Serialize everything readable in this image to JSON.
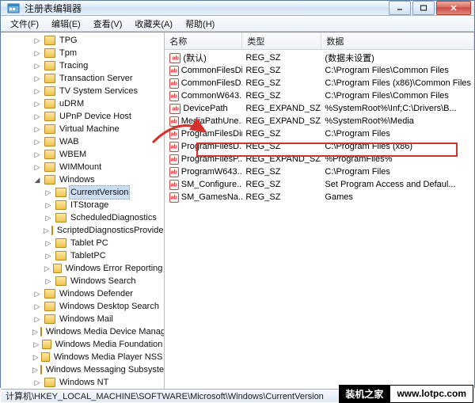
{
  "title": "注册表编辑器",
  "menu": [
    "文件(F)",
    "编辑(E)",
    "查看(V)",
    "收藏夹(A)",
    "帮助(H)"
  ],
  "tree": {
    "indent_base": 40,
    "indent_step": 14,
    "nodes": [
      {
        "label": "TPG",
        "level": 0,
        "exp": "▷"
      },
      {
        "label": "Tpm",
        "level": 0,
        "exp": "▷"
      },
      {
        "label": "Tracing",
        "level": 0,
        "exp": "▷"
      },
      {
        "label": "Transaction Server",
        "level": 0,
        "exp": "▷"
      },
      {
        "label": "TV System Services",
        "level": 0,
        "exp": "▷"
      },
      {
        "label": "uDRM",
        "level": 0,
        "exp": "▷"
      },
      {
        "label": "UPnP Device Host",
        "level": 0,
        "exp": "▷"
      },
      {
        "label": "Virtual Machine",
        "level": 0,
        "exp": "▷"
      },
      {
        "label": "WAB",
        "level": 0,
        "exp": "▷"
      },
      {
        "label": "WBEM",
        "level": 0,
        "exp": "▷"
      },
      {
        "label": "WIMMount",
        "level": 0,
        "exp": "▷"
      },
      {
        "label": "Windows",
        "level": 0,
        "exp": "◢"
      },
      {
        "label": "CurrentVersion",
        "level": 1,
        "exp": "▷",
        "selected": true
      },
      {
        "label": "ITStorage",
        "level": 1,
        "exp": "▷"
      },
      {
        "label": "ScheduledDiagnostics",
        "level": 1,
        "exp": "▷"
      },
      {
        "label": "ScriptedDiagnosticsProvider",
        "level": 1,
        "exp": "▷"
      },
      {
        "label": "Tablet PC",
        "level": 1,
        "exp": "▷"
      },
      {
        "label": "TabletPC",
        "level": 1,
        "exp": "▷"
      },
      {
        "label": "Windows Error Reporting",
        "level": 1,
        "exp": "▷"
      },
      {
        "label": "Windows Search",
        "level": 1,
        "exp": "▷"
      },
      {
        "label": "Windows Defender",
        "level": 0,
        "exp": "▷"
      },
      {
        "label": "Windows Desktop Search",
        "level": 0,
        "exp": "▷"
      },
      {
        "label": "Windows Mail",
        "level": 0,
        "exp": "▷"
      },
      {
        "label": "Windows Media Device Manager",
        "level": 0,
        "exp": "▷"
      },
      {
        "label": "Windows Media Foundation",
        "level": 0,
        "exp": "▷"
      },
      {
        "label": "Windows Media Player NSS",
        "level": 0,
        "exp": "▷"
      },
      {
        "label": "Windows Messaging Subsystem",
        "level": 0,
        "exp": "▷"
      },
      {
        "label": "Windows NT",
        "level": 0,
        "exp": "▷"
      }
    ]
  },
  "list": {
    "headers": {
      "name": "名称",
      "type": "类型",
      "data": "数据"
    },
    "rows": [
      {
        "name": "(默认)",
        "type": "REG_SZ",
        "data": "(数据未设置)"
      },
      {
        "name": "CommonFilesDir",
        "type": "REG_SZ",
        "data": "C:\\Program Files\\Common Files"
      },
      {
        "name": "CommonFilesD...",
        "type": "REG_SZ",
        "data": "C:\\Program Files (x86)\\Common Files"
      },
      {
        "name": "CommonW643...",
        "type": "REG_SZ",
        "data": "C:\\Program Files\\Common Files"
      },
      {
        "name": "DevicePath",
        "type": "REG_EXPAND_SZ",
        "data": "%SystemRoot%\\Inf;C:\\Drivers\\B..."
      },
      {
        "name": "MediaPathUne...",
        "type": "REG_EXPAND_SZ",
        "data": "%SystemRoot%\\Media"
      },
      {
        "name": "ProgramFilesDir",
        "type": "REG_SZ",
        "data": "C:\\Program Files"
      },
      {
        "name": "ProgramFilesD...",
        "type": "REG_SZ",
        "data": "C:\\Program Files (x86)"
      },
      {
        "name": "ProgramFilesP...",
        "type": "REG_EXPAND_SZ",
        "data": "%ProgramFiles%"
      },
      {
        "name": "ProgramW643...",
        "type": "REG_SZ",
        "data": "C:\\Program Files"
      },
      {
        "name": "SM_Configure...",
        "type": "REG_SZ",
        "data": "Set Program Access and Defaul..."
      },
      {
        "name": "SM_GamesNa...",
        "type": "REG_SZ",
        "data": "Games"
      }
    ]
  },
  "status": "计算机\\HKEY_LOCAL_MACHINE\\SOFTWARE\\Microsoft\\Windows\\CurrentVersion",
  "watermark": {
    "site_cn": "装机之家",
    "site_url": "www.lotpc.com"
  }
}
